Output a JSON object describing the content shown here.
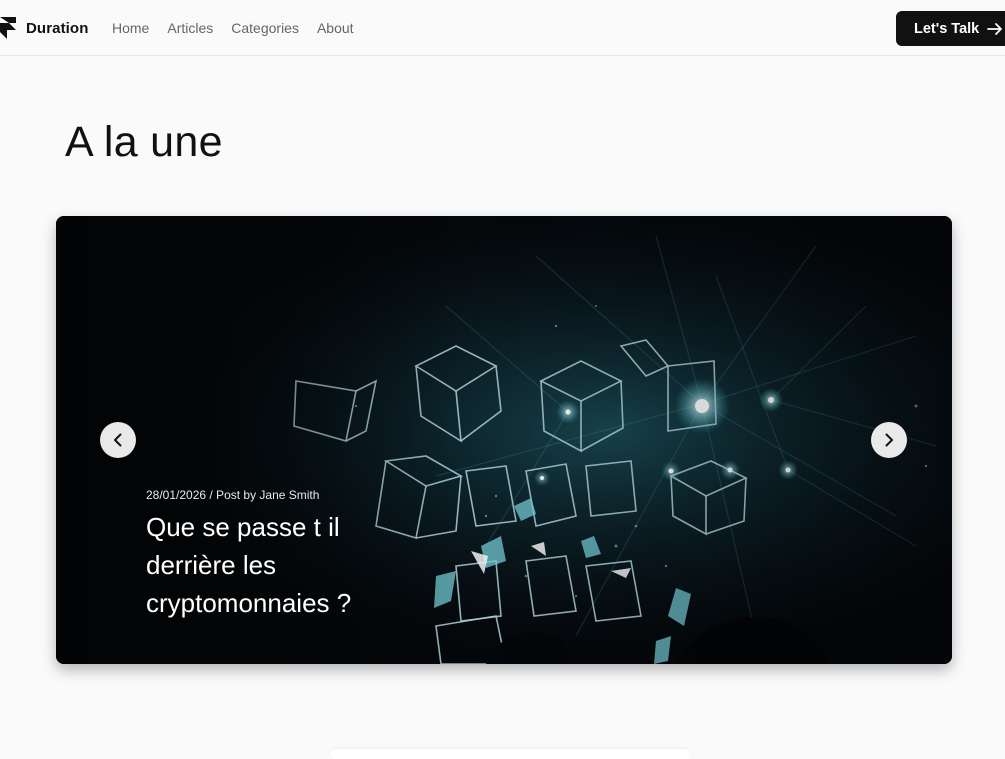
{
  "header": {
    "brand_name": "Duration",
    "nav": [
      "Home",
      "Articles",
      "Categories",
      "About"
    ],
    "cta_label": "Let's Talk"
  },
  "main": {
    "title": "A la une"
  },
  "carousel": {
    "slide": {
      "meta": "28/01/2026 / Post by Jane Smith",
      "title": "Que se passe t il derrière les cryptomonnaies ?"
    }
  },
  "colors": {
    "background": "#fafafa",
    "cta_background": "#111111",
    "accent_light": "#2fb7c6"
  },
  "icons": {
    "logo": "duration-logo-icon",
    "cta": "arrow-right-icon",
    "prev": "chevron-left-icon",
    "next": "chevron-right-icon"
  }
}
